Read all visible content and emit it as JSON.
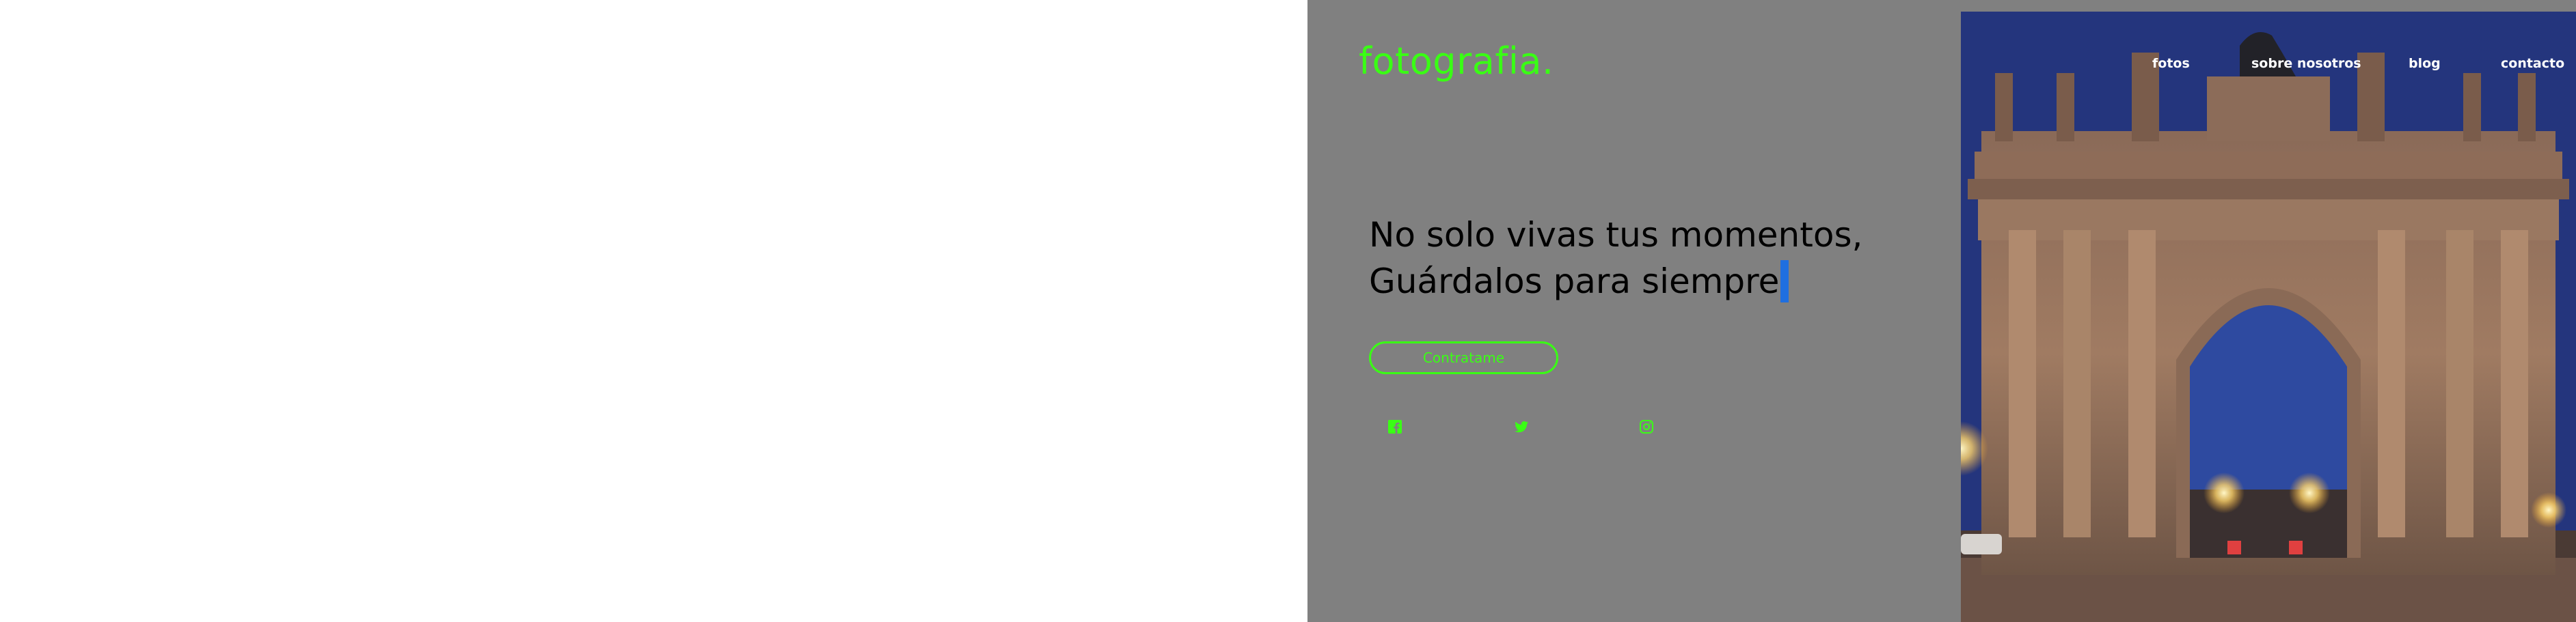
{
  "brand": {
    "logo_text": "fotografia."
  },
  "nav": {
    "items": [
      {
        "label": "fotos"
      },
      {
        "label": "sobre nosotros"
      },
      {
        "label": "blog"
      },
      {
        "label": "contacto"
      }
    ]
  },
  "hero": {
    "headline_line1": "No solo vivas tus momentos,",
    "headline_line2": "Guárdalos para siempre",
    "cta_label": "Contratame"
  },
  "socials": [
    {
      "icon": "facebook-icon"
    },
    {
      "icon": "twitter-icon"
    },
    {
      "icon": "instagram-icon"
    }
  ],
  "colors": {
    "accent": "#39ff14",
    "panel": "#808080",
    "headline": "#000000",
    "nav_text": "#ffffff",
    "selection": "#1f6fe0"
  }
}
